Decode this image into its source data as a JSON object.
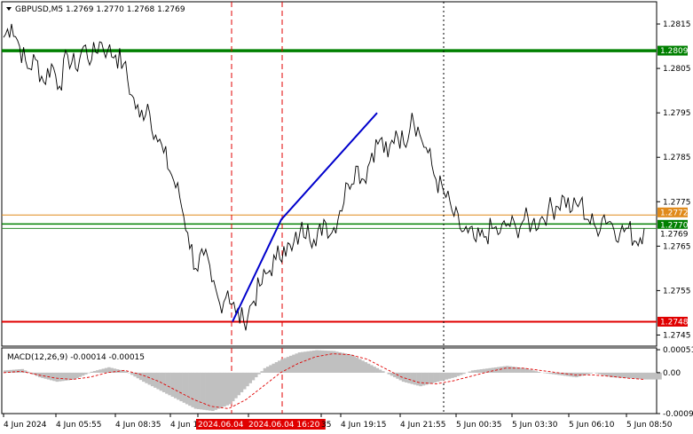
{
  "chart_header": {
    "symbol_line": "GBPUSD,M5  1.2769 1.2770 1.2768 1.2769",
    "menu_icon": "triangle-down-icon"
  },
  "macd_header": {
    "label": "MACD(12,26,9) -0.00014 -0.00015"
  },
  "colors": {
    "background": "#ffffff",
    "price_line": "#000000",
    "trend_line": "#0000cc",
    "level_green": "#008000",
    "level_thin_green": "#2e8b2e",
    "level_orange": "#e08a1a",
    "level_red": "#e00000",
    "vline_red": "#e00000",
    "vline_dark": "#000000",
    "macd_hist": "#c0c0c0",
    "macd_signal": "#e00000",
    "time_highlight": "#e00000"
  },
  "chart_data": {
    "type": "line",
    "price_axis": {
      "ticks": [
        "1.2815",
        "1.2805",
        "1.2795",
        "1.2785",
        "1.2775",
        "1.2765",
        "1.2755",
        "1.2745"
      ],
      "range": [
        1.27425,
        1.282
      ]
    },
    "levels": [
      {
        "label": "1.2809",
        "value": 1.2809,
        "style": "thick-green"
      },
      {
        "label": "1.2772",
        "value": 1.2772,
        "style": "orange"
      },
      {
        "label": "1.2770",
        "value": 1.277,
        "style": "green"
      },
      {
        "label": "1.2769",
        "value": 1.2769,
        "style": "thin-green"
      },
      {
        "label": "1.2748",
        "value": 1.2748,
        "style": "red"
      }
    ],
    "current_price": "1.2769",
    "time_axis": [
      "4 Jun 2024",
      "4 Jun 05:55",
      "4 Jun 08:35",
      "4 Jun 1",
      "2024.06.04 1",
      "2024.06.04 16:20",
      "35",
      "4 Jun 19:15",
      "4 Jun 21:55",
      "5 Jun 00:35",
      "5 Jun 03:30",
      "5 Jun 06:10",
      "5 Jun 08:50"
    ],
    "highlighted_times": [
      "2024.06.04 1",
      "2024.06.04 16:20"
    ],
    "macd_axis": {
      "ticks": [
        "0.00051",
        "0.00",
        "-0.00091"
      ],
      "range": [
        -0.00091,
        0.00055
      ]
    },
    "price_series": [
      1.2812,
      1.2815,
      1.281,
      1.2805,
      1.2807,
      1.2802,
      1.2806,
      1.2801,
      1.2808,
      1.2805,
      1.281,
      1.2807,
      1.2811,
      1.2809,
      1.2808,
      1.2806,
      1.2799,
      1.2794,
      1.2797,
      1.279,
      1.2786,
      1.2781,
      1.2776,
      1.2768,
      1.276,
      1.2763,
      1.2757,
      1.2752,
      1.2755,
      1.275,
      1.2748,
      1.2752,
      1.2756,
      1.2759,
      1.2762,
      1.2765,
      1.2764,
      1.2768,
      1.277,
      1.2765,
      1.2771,
      1.2768,
      1.2773,
      1.2779,
      1.2783,
      1.278,
      1.2786,
      1.2789,
      1.2785,
      1.2791,
      1.2788,
      1.2795,
      1.279,
      1.2786,
      1.278,
      1.2777,
      1.2773,
      1.2769,
      1.2768,
      1.2766,
      1.2767,
      1.2769,
      1.2768,
      1.277,
      1.2769,
      1.2771,
      1.277,
      1.2771,
      1.2773,
      1.2774,
      1.2776,
      1.2773,
      1.2775,
      1.2771,
      1.2769,
      1.2772,
      1.277,
      1.2768,
      1.2769,
      1.2766,
      1.2769
    ],
    "trend_line_points": [
      [
        1.2748
      ],
      [
        1.2771
      ],
      [
        1.2795
      ]
    ],
    "macd_hist": [
      5e-05,
      8e-05,
      -0.0001,
      -0.0002,
      -0.00015,
      2e-05,
      0.00012,
      3e-05,
      -0.0002,
      -0.0004,
      -0.0006,
      -0.0008,
      -0.00085,
      -0.0007,
      -0.0003,
      0.0001,
      0.0003,
      0.00045,
      0.0005,
      0.00048,
      0.0004,
      0.0002,
      0.0,
      -0.0002,
      -0.0003,
      -0.0002,
      -0.0001,
      5e-05,
      0.0001,
      0.00015,
      0.0001,
      0.0,
      -5e-05,
      -0.0001,
      0.0,
      -0.0001,
      -0.00012,
      -0.00015
    ],
    "macd_signal": [
      0.0,
      3e-05,
      -5e-05,
      -0.00012,
      -0.00015,
      -0.0001,
      0.0,
      5e-05,
      -5e-05,
      -0.0002,
      -0.0004,
      -0.0006,
      -0.00075,
      -0.0008,
      -0.0006,
      -0.0003,
      0.0,
      0.0002,
      0.00035,
      0.00042,
      0.0004,
      0.0003,
      0.0001,
      -0.0001,
      -0.00022,
      -0.00025,
      -0.00018,
      -8e-05,
      2e-05,
      0.0001,
      0.0001,
      5e-05,
      0.0,
      -5e-05,
      -5e-05,
      -8e-05,
      -0.00012,
      -0.00015
    ]
  }
}
